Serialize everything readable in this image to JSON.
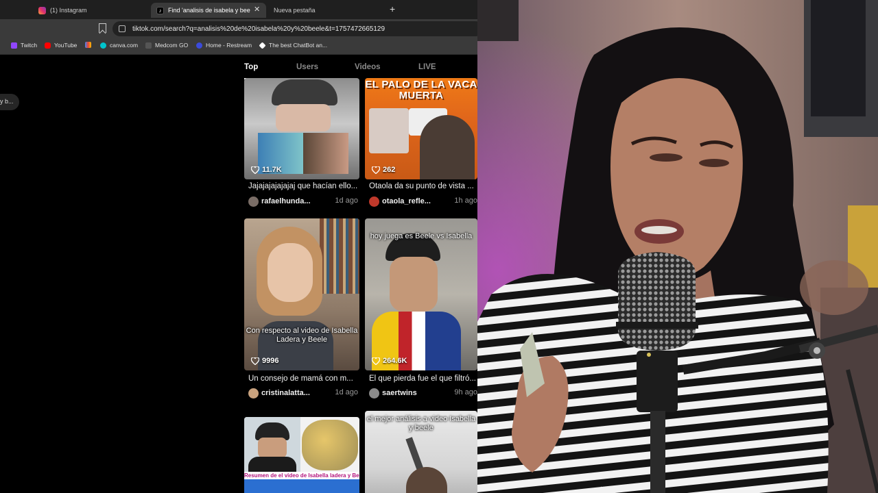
{
  "tabs": [
    {
      "label": "(1) Instagram",
      "favicon": "instagram-icon",
      "active": false
    },
    {
      "label": "Find 'analisis de isabela y beele'",
      "favicon": "tiktok-icon",
      "active": true
    },
    {
      "label": "Nueva pestaña",
      "favicon": "",
      "active": false
    }
  ],
  "address": {
    "url": "tiktok.com/search?q=analisis%20de%20isabela%20y%20beele&t=1757472665129"
  },
  "bookmarks": [
    {
      "label": "Twitch",
      "icon": "twitch-icon",
      "color": "#9146ff"
    },
    {
      "label": "YouTube",
      "icon": "youtube-icon",
      "color": "#ff0000"
    },
    {
      "label": "",
      "icon": "gmail-icon",
      "color": "#ea4335"
    },
    {
      "label": "canva.com",
      "icon": "canva-icon",
      "color": "#00c4cc"
    },
    {
      "label": "Medcom GO",
      "icon": "medcom-icon",
      "color": "#555555"
    },
    {
      "label": "Home - Restream",
      "icon": "restream-icon",
      "color": "#3b4bdb"
    },
    {
      "label": "The best ChatBot an...",
      "icon": "chatbot-icon",
      "color": "#ffffff"
    }
  ],
  "sidebar": {
    "search_pill": "y b..."
  },
  "result_tabs": [
    "Top",
    "Users",
    "Videos",
    "LIVE"
  ],
  "videos": [
    {
      "likes": "11.7K",
      "title": "Jajajajajajajaj que hacían ello...",
      "author": "rafaelhunda...",
      "date": "1d ago",
      "overlay": ""
    },
    {
      "likes": "262",
      "title": "Otaola da su punto de vista ...",
      "author": "otaola_refle...",
      "date": "1h ago",
      "overlay": "EL PALO DE LA VACA MUERTA"
    },
    {
      "likes": "9996",
      "title": "Un consejo de mamá con m...",
      "author": "cristinalatta...",
      "date": "1d ago",
      "overlay": "Con respecto al video de Isabella Ladera y Beele"
    },
    {
      "likes": "264.6K",
      "title": "El que pierda fue el que filtró...",
      "author": "saertwins",
      "date": "9h ago",
      "overlay": "hoy juega es Beele vs Isabella"
    },
    {
      "likes": "",
      "title": "",
      "author": "",
      "date": "",
      "overlay": "Resumen de el video de Isabella ladera y Beele"
    },
    {
      "likes": "",
      "title": "",
      "author": "",
      "date": "",
      "overlay": "el mejor análisis a video Isabella y beele"
    }
  ],
  "colors": {
    "tiktok_bg": "#000000",
    "chrome_frame": "#1f1f1f",
    "chrome_toolbar": "#3a3a3a",
    "accent_pink": "#b3137c"
  }
}
